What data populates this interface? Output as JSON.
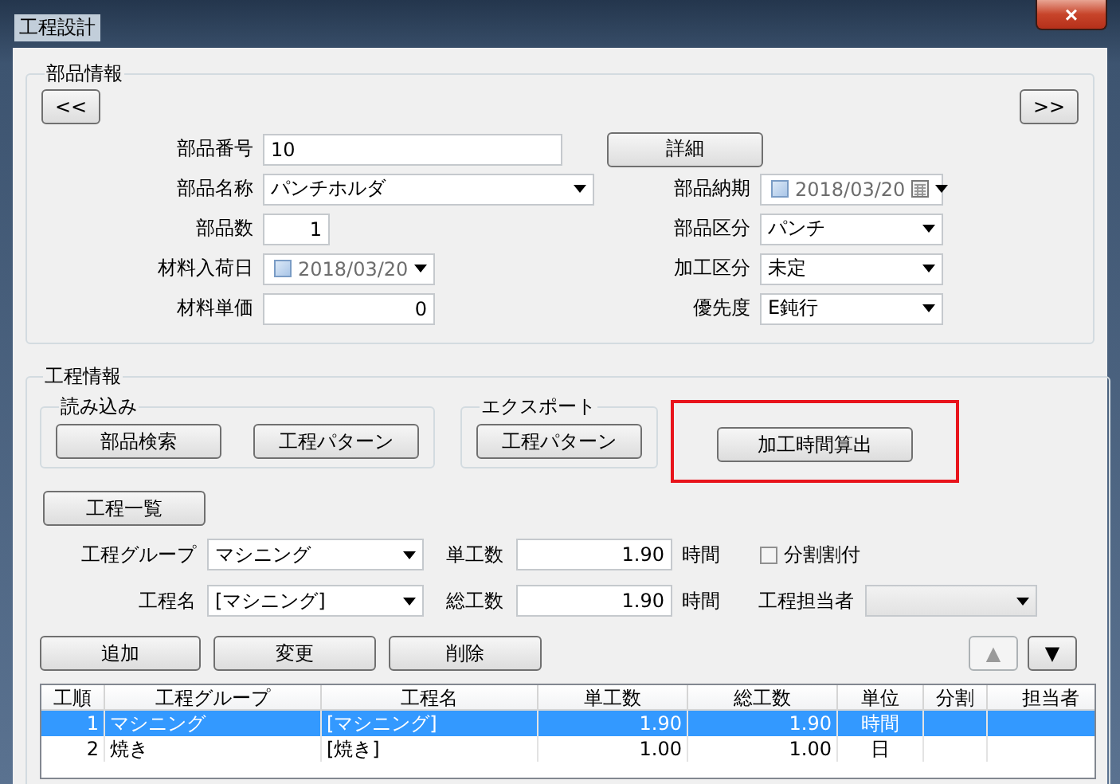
{
  "window": {
    "title": "工程設計",
    "close_button": "×"
  },
  "part_info": {
    "title": "部品情報",
    "prev_button": "<<",
    "next_button": ">>",
    "detail_button": "詳細",
    "left_fields": [
      {
        "kind": "text",
        "label": "部品番号",
        "value": "10"
      },
      {
        "kind": "combo",
        "label": "部品名称",
        "value": "パンチホルダ"
      },
      {
        "kind": "number",
        "label": "部品数",
        "value": "1"
      },
      {
        "kind": "date",
        "label": "材料入荷日",
        "value": "2018/03/20",
        "checked": false
      },
      {
        "kind": "number",
        "label": "材料単価",
        "value": "0"
      }
    ],
    "right_fields": [
      {
        "kind": "date_calendar",
        "label": "部品納期",
        "value": "2018/03/20",
        "checked": false
      },
      {
        "kind": "combo",
        "label": "部品区分",
        "value": "パンチ"
      },
      {
        "kind": "combo",
        "label": "加工区分",
        "value": "未定"
      },
      {
        "kind": "combo",
        "label": "優先度",
        "value": "E鈍行"
      }
    ]
  },
  "process_info": {
    "title": "工程情報",
    "import_group": {
      "title": "読み込み",
      "buttons": [
        "部品検索",
        "工程パターン"
      ]
    },
    "export_group": {
      "title": "エクスポート",
      "buttons": [
        "工程パターン"
      ]
    },
    "calc_button": {
      "label": "加工時間算出",
      "highlighted": true
    },
    "list_button": "工程一覧",
    "group_field": {
      "label": "工程グループ",
      "value": "マシニング"
    },
    "name_field": {
      "label": "工程名",
      "value": "[マシニング]"
    },
    "unit_work": {
      "label": "単工数",
      "value": "1.90",
      "unit": "時間"
    },
    "total_work": {
      "label": "総工数",
      "value": "1.90",
      "unit": "時間"
    },
    "split": {
      "label": "分割割付",
      "checked": false
    },
    "assignee": {
      "label": "工程担当者"
    },
    "action_buttons": [
      "追加",
      "変更",
      "削除"
    ],
    "move_buttons": [
      {
        "symbol": "▲",
        "disabled": true
      },
      {
        "symbol": "▼",
        "disabled": false
      }
    ],
    "table": {
      "columns": [
        "工順",
        "工程グループ",
        "工程名",
        "単工数",
        "総工数",
        "単位",
        "分割",
        "担当者"
      ],
      "rows": [
        {
          "selected": true,
          "cells": [
            "1",
            "マシニング",
            "[マシニング]",
            "1.90",
            "1.90",
            "時間"
          ]
        },
        {
          "selected": false,
          "cells": [
            "2",
            "焼き",
            "[焼き]",
            "1.00",
            "1.00",
            "日"
          ]
        }
      ]
    }
  }
}
